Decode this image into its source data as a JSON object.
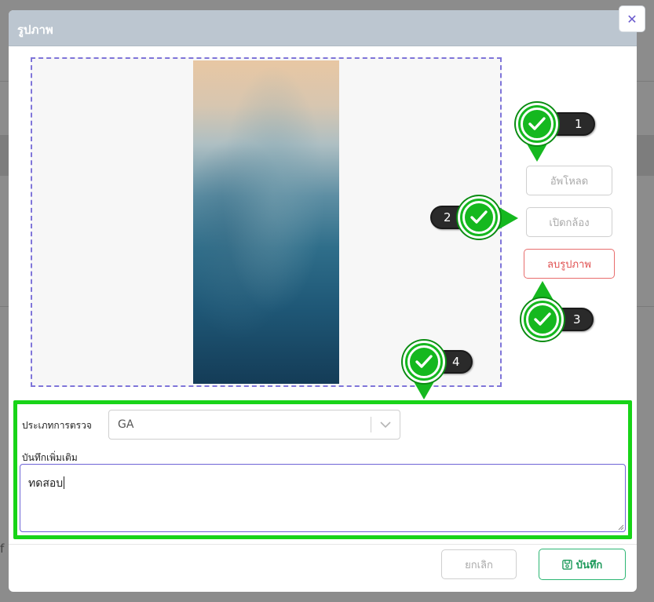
{
  "modal": {
    "title": "รูปภาพ",
    "close_symbol": "✕"
  },
  "image_actions": {
    "upload_label": "อัพโหลด",
    "camera_label": "เปิดกล้อง",
    "delete_label": "ลบรูปภาพ"
  },
  "form": {
    "type_label": "ประเภทการตรวจ",
    "type_value": "GA",
    "note_label": "บันทึกเพิ่มเติม",
    "note_value": "ทดสอบ"
  },
  "footer": {
    "cancel_label": "ยกเลิก",
    "save_label": "บันทึก"
  },
  "callouts": {
    "c1": "1",
    "c2": "2",
    "c3": "3",
    "c4": "4"
  },
  "background": {
    "fragment": "f"
  },
  "colors": {
    "check_green": "#15b81f",
    "highlight_green": "#18d418",
    "danger": "#e04f4f",
    "save_green": "#1d9a5b"
  },
  "icons": {
    "close": "close-icon",
    "check": "check-icon",
    "chevron": "chevron-down-icon",
    "save": "floppy-disk-icon"
  }
}
